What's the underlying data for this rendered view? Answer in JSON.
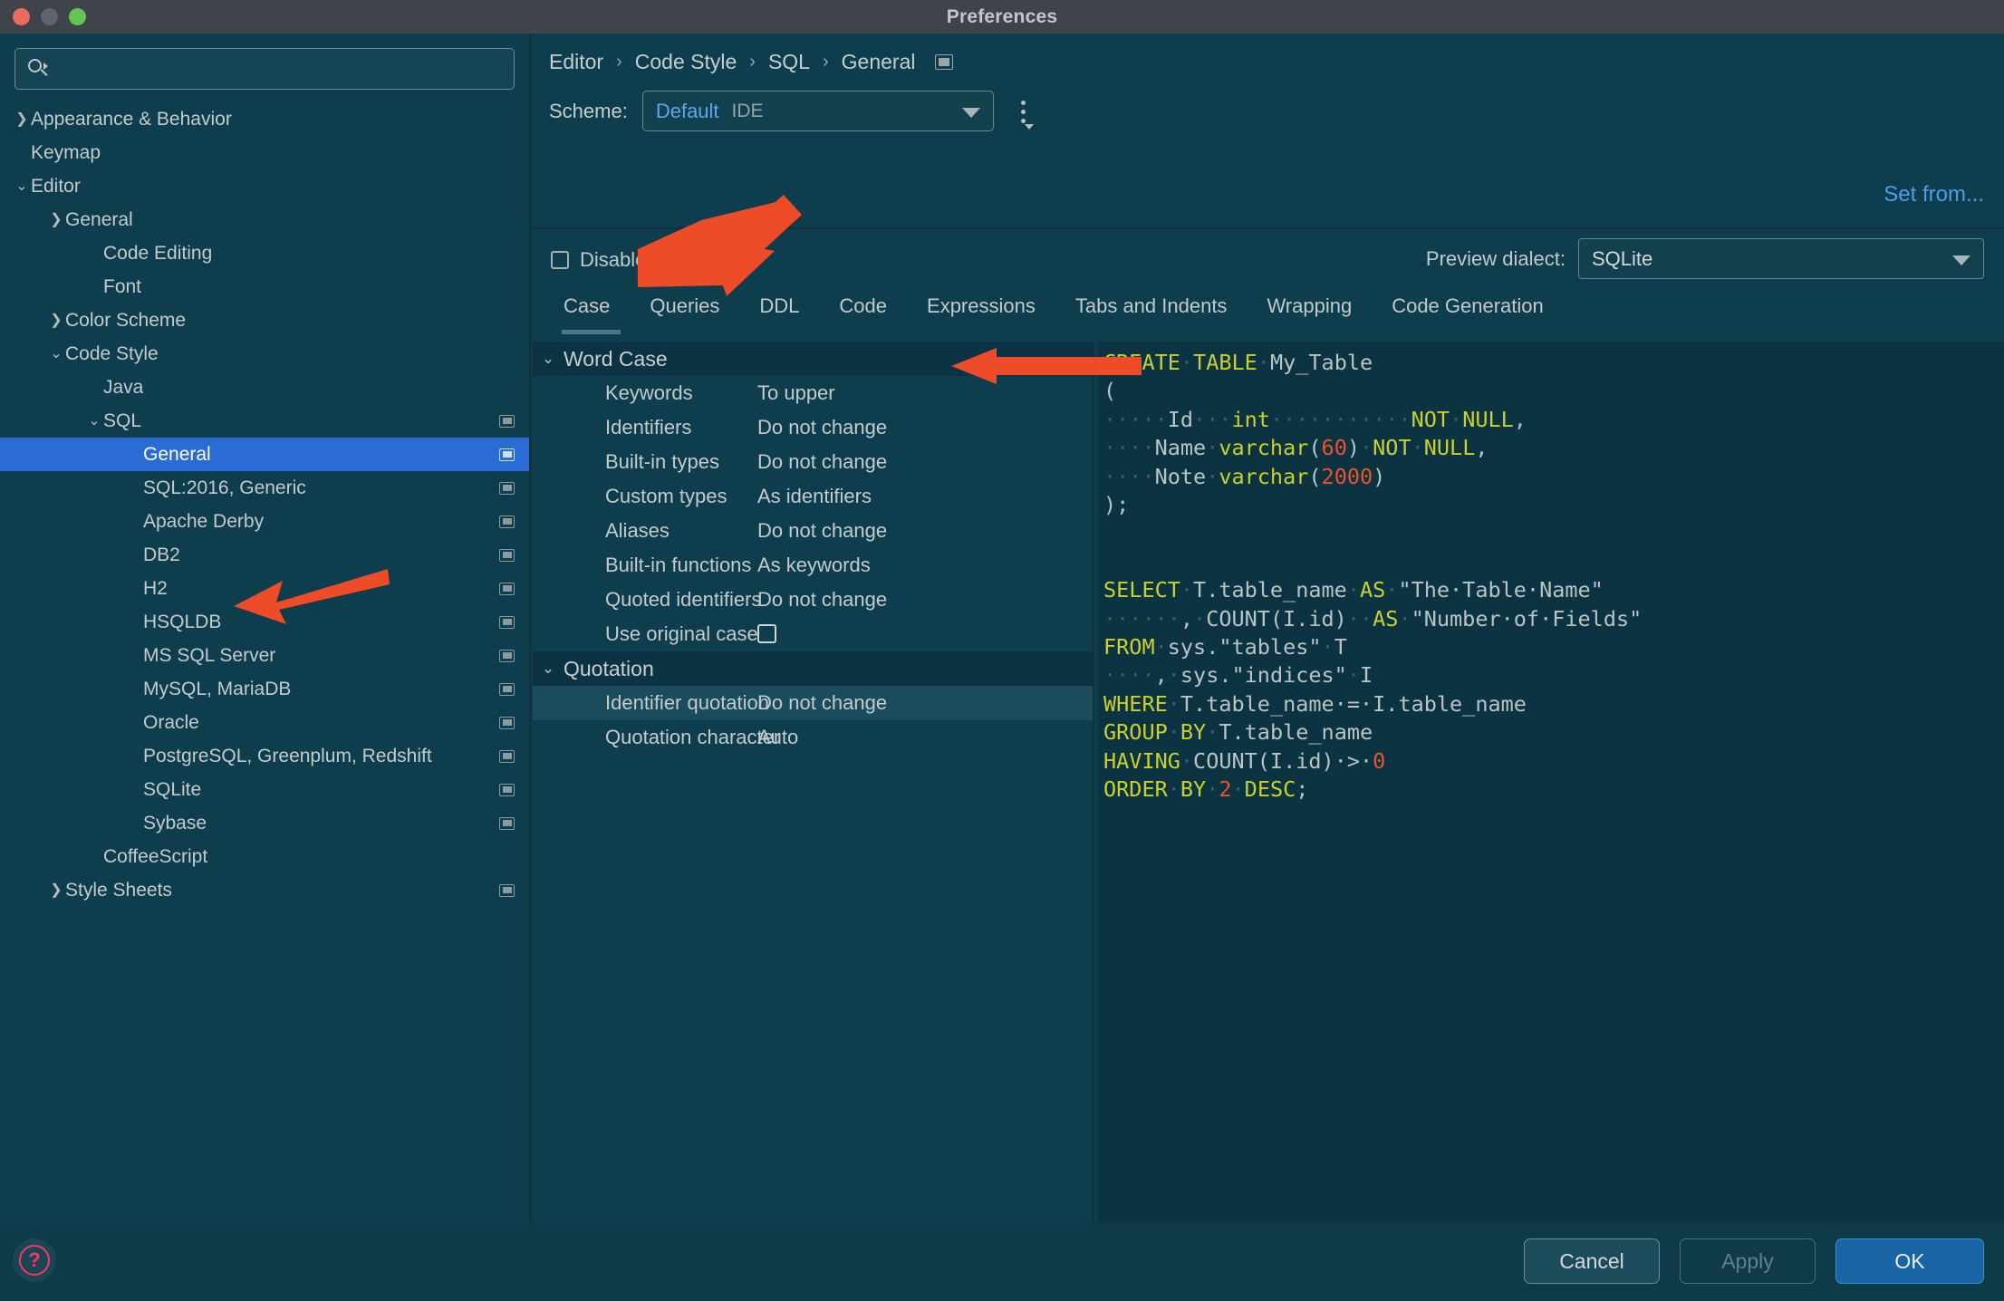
{
  "window": {
    "title": "Preferences",
    "traffic_lights": [
      "close-red",
      "minimize-gray",
      "maximize-green"
    ]
  },
  "sidebar": {
    "search": {
      "value": "",
      "placeholder": ""
    },
    "items": [
      {
        "label": "Appearance & Behavior",
        "level": 0,
        "chevron": "right",
        "badge": false,
        "selected": false
      },
      {
        "label": "Keymap",
        "level": 1,
        "chevron": "none",
        "badge": false,
        "selected": false
      },
      {
        "label": "Editor",
        "level": 0,
        "chevron": "down",
        "badge": false,
        "selected": false
      },
      {
        "label": "General",
        "level": 2,
        "chevron": "right",
        "badge": false,
        "selected": false
      },
      {
        "label": "Code Editing",
        "level": 3,
        "chevron": "none",
        "badge": false,
        "selected": false
      },
      {
        "label": "Font",
        "level": 3,
        "chevron": "none",
        "badge": false,
        "selected": false
      },
      {
        "label": "Color Scheme",
        "level": 2,
        "chevron": "right",
        "badge": false,
        "selected": false
      },
      {
        "label": "Code Style",
        "level": 2,
        "chevron": "down",
        "badge": false,
        "selected": false
      },
      {
        "label": "Java",
        "level": 3,
        "chevron": "none",
        "badge": false,
        "selected": false
      },
      {
        "label": "SQL",
        "level": 3,
        "chevron": "down",
        "badge": true,
        "selected": false
      },
      {
        "label": "General",
        "level": 4,
        "chevron": "none",
        "badge": true,
        "selected": true
      },
      {
        "label": "SQL:2016, Generic",
        "level": 4,
        "chevron": "none",
        "badge": true,
        "selected": false
      },
      {
        "label": "Apache Derby",
        "level": 4,
        "chevron": "none",
        "badge": true,
        "selected": false
      },
      {
        "label": "DB2",
        "level": 4,
        "chevron": "none",
        "badge": true,
        "selected": false
      },
      {
        "label": "H2",
        "level": 4,
        "chevron": "none",
        "badge": true,
        "selected": false
      },
      {
        "label": "HSQLDB",
        "level": 4,
        "chevron": "none",
        "badge": true,
        "selected": false
      },
      {
        "label": "MS SQL Server",
        "level": 4,
        "chevron": "none",
        "badge": true,
        "selected": false
      },
      {
        "label": "MySQL, MariaDB",
        "level": 4,
        "chevron": "none",
        "badge": true,
        "selected": false
      },
      {
        "label": "Oracle",
        "level": 4,
        "chevron": "none",
        "badge": true,
        "selected": false
      },
      {
        "label": "PostgreSQL, Greenplum, Redshift",
        "level": 4,
        "chevron": "none",
        "badge": true,
        "selected": false
      },
      {
        "label": "SQLite",
        "level": 4,
        "chevron": "none",
        "badge": true,
        "selected": false
      },
      {
        "label": "Sybase",
        "level": 4,
        "chevron": "none",
        "badge": true,
        "selected": false
      },
      {
        "label": "CoffeeScript",
        "level": 3,
        "chevron": "none",
        "badge": false,
        "selected": false
      },
      {
        "label": "Style Sheets",
        "level": 2,
        "chevron": "right",
        "badge": true,
        "selected": false
      }
    ]
  },
  "header": {
    "breadcrumb": [
      "Editor",
      "Code Style",
      "SQL",
      "General"
    ],
    "breadcrumb_separator": "›",
    "scheme_label": "Scheme:",
    "scheme_value": "Default",
    "scheme_scope": "IDE",
    "set_from_label": "Set from...",
    "disable_formatting_label": "Disable formatting",
    "disable_formatting_checked": false,
    "preview_dialect_label": "Preview dialect:",
    "preview_dialect_value": "SQLite"
  },
  "tabs": [
    {
      "label": "Case",
      "active": true
    },
    {
      "label": "Queries",
      "active": false
    },
    {
      "label": "DDL",
      "active": false
    },
    {
      "label": "Code",
      "active": false
    },
    {
      "label": "Expressions",
      "active": false
    },
    {
      "label": "Tabs and Indents",
      "active": false
    },
    {
      "label": "Wrapping",
      "active": false
    },
    {
      "label": "Code Generation",
      "active": false
    }
  ],
  "settings": [
    {
      "kind": "group",
      "label": "Word Case",
      "expanded": true
    },
    {
      "kind": "item",
      "label": "Keywords",
      "value": "To upper",
      "type": "text",
      "highlight": false
    },
    {
      "kind": "item",
      "label": "Identifiers",
      "value": "Do not change",
      "type": "text",
      "highlight": false
    },
    {
      "kind": "item",
      "label": "Built-in types",
      "value": "Do not change",
      "type": "text",
      "highlight": false
    },
    {
      "kind": "item",
      "label": "Custom types",
      "value": "As identifiers",
      "type": "text",
      "highlight": false
    },
    {
      "kind": "item",
      "label": "Aliases",
      "value": "Do not change",
      "type": "text",
      "highlight": false
    },
    {
      "kind": "item",
      "label": "Built-in functions",
      "value": "As keywords",
      "type": "text",
      "highlight": false
    },
    {
      "kind": "item",
      "label": "Quoted identifiers",
      "value": "Do not change",
      "type": "text",
      "highlight": false
    },
    {
      "kind": "item",
      "label": "Use original case",
      "value": "",
      "type": "checkbox",
      "checked": false,
      "highlight": false
    },
    {
      "kind": "group",
      "label": "Quotation",
      "expanded": true
    },
    {
      "kind": "item",
      "label": "Identifier quotation",
      "value": "Do not change",
      "type": "text",
      "highlight": true
    },
    {
      "kind": "item",
      "label": "Quotation character",
      "value": "Auto",
      "type": "text",
      "highlight": false
    }
  ],
  "preview": {
    "lines": [
      [
        {
          "t": "CREATE",
          "c": "kw"
        },
        {
          "t": "·",
          "c": "ws"
        },
        {
          "t": "TABLE",
          "c": "kw"
        },
        {
          "t": "·",
          "c": "ws"
        },
        {
          "t": "My_Table",
          "c": "id"
        }
      ],
      [
        {
          "t": "(",
          "c": "id"
        }
      ],
      [
        {
          "t": "·····",
          "c": "ws"
        },
        {
          "t": "Id",
          "c": "id"
        },
        {
          "t": "···",
          "c": "ws"
        },
        {
          "t": "int",
          "c": "kw"
        },
        {
          "t": "···········",
          "c": "ws"
        },
        {
          "t": "NOT",
          "c": "kw"
        },
        {
          "t": "·",
          "c": "ws"
        },
        {
          "t": "NULL",
          "c": "kw"
        },
        {
          "t": ",",
          "c": "id"
        }
      ],
      [
        {
          "t": "····",
          "c": "ws"
        },
        {
          "t": "Name",
          "c": "id"
        },
        {
          "t": "·",
          "c": "ws"
        },
        {
          "t": "varchar",
          "c": "kw"
        },
        {
          "t": "(",
          "c": "id"
        },
        {
          "t": "60",
          "c": "num"
        },
        {
          "t": ")",
          "c": "id"
        },
        {
          "t": "·",
          "c": "ws"
        },
        {
          "t": "NOT",
          "c": "kw"
        },
        {
          "t": "·",
          "c": "ws"
        },
        {
          "t": "NULL",
          "c": "kw"
        },
        {
          "t": ",",
          "c": "id"
        }
      ],
      [
        {
          "t": "····",
          "c": "ws"
        },
        {
          "t": "Note",
          "c": "id"
        },
        {
          "t": "·",
          "c": "ws"
        },
        {
          "t": "varchar",
          "c": "kw"
        },
        {
          "t": "(",
          "c": "id"
        },
        {
          "t": "2000",
          "c": "num"
        },
        {
          "t": ")",
          "c": "id"
        }
      ],
      [
        {
          "t": ");",
          "c": "id"
        }
      ],
      [
        {
          "t": "",
          "c": "id"
        }
      ],
      [
        {
          "t": "",
          "c": "id"
        }
      ],
      [
        {
          "t": "SELECT",
          "c": "kw"
        },
        {
          "t": "·",
          "c": "ws"
        },
        {
          "t": "T.table_name",
          "c": "id"
        },
        {
          "t": "·",
          "c": "ws"
        },
        {
          "t": "AS",
          "c": "kw"
        },
        {
          "t": "·",
          "c": "ws"
        },
        {
          "t": "\"The·Table·Name\"",
          "c": "id"
        }
      ],
      [
        {
          "t": "······",
          "c": "ws"
        },
        {
          "t": ",",
          "c": "id"
        },
        {
          "t": "·",
          "c": "ws"
        },
        {
          "t": "COUNT(I.id)",
          "c": "id"
        },
        {
          "t": "··",
          "c": "ws"
        },
        {
          "t": "AS",
          "c": "kw"
        },
        {
          "t": "·",
          "c": "ws"
        },
        {
          "t": "\"Number·of·Fields\"",
          "c": "id"
        }
      ],
      [
        {
          "t": "FROM",
          "c": "kw"
        },
        {
          "t": "·",
          "c": "ws"
        },
        {
          "t": "sys.\"tables\"",
          "c": "id"
        },
        {
          "t": "·",
          "c": "ws"
        },
        {
          "t": "T",
          "c": "id"
        }
      ],
      [
        {
          "t": "····",
          "c": "ws"
        },
        {
          "t": ",",
          "c": "id"
        },
        {
          "t": "·",
          "c": "ws"
        },
        {
          "t": "sys.\"indices\"",
          "c": "id"
        },
        {
          "t": "·",
          "c": "ws"
        },
        {
          "t": "I",
          "c": "id"
        }
      ],
      [
        {
          "t": "WHERE",
          "c": "kw"
        },
        {
          "t": "·",
          "c": "ws"
        },
        {
          "t": "T.table_name",
          "c": "id"
        },
        {
          "t": "·=·",
          "c": "id"
        },
        {
          "t": "I.table_name",
          "c": "id"
        }
      ],
      [
        {
          "t": "GROUP",
          "c": "kw"
        },
        {
          "t": "·",
          "c": "ws"
        },
        {
          "t": "BY",
          "c": "kw"
        },
        {
          "t": "·",
          "c": "ws"
        },
        {
          "t": "T.table_name",
          "c": "id"
        }
      ],
      [
        {
          "t": "HAVING",
          "c": "kw"
        },
        {
          "t": "·",
          "c": "ws"
        },
        {
          "t": "COUNT(I.id)",
          "c": "id"
        },
        {
          "t": "·>·",
          "c": "id"
        },
        {
          "t": "0",
          "c": "num"
        }
      ],
      [
        {
          "t": "ORDER",
          "c": "kw"
        },
        {
          "t": "·",
          "c": "ws"
        },
        {
          "t": "BY",
          "c": "kw"
        },
        {
          "t": "·",
          "c": "ws"
        },
        {
          "t": "2",
          "c": "num"
        },
        {
          "t": "·",
          "c": "ws"
        },
        {
          "t": "DESC",
          "c": "kw"
        },
        {
          "t": ";",
          "c": "id"
        }
      ]
    ]
  },
  "footer": {
    "help_glyph": "?",
    "cancel_label": "Cancel",
    "apply_label": "Apply",
    "apply_enabled": false,
    "ok_label": "OK"
  },
  "colors": {
    "accent_blue": "#2b6cd4",
    "link_blue": "#4f9ce8",
    "annotation_red": "#ee4b28",
    "keyword_yellow": "#cad12a",
    "number_orange": "#e8552a",
    "help_pink": "#f4386a"
  },
  "annotations": [
    {
      "name": "arrow-to-disable-formatting-area",
      "color": "#ee4b28"
    },
    {
      "name": "arrow-to-keywords-value",
      "color": "#ee4b28"
    },
    {
      "name": "arrow-to-sidebar-general",
      "color": "#ee4b28"
    }
  ]
}
